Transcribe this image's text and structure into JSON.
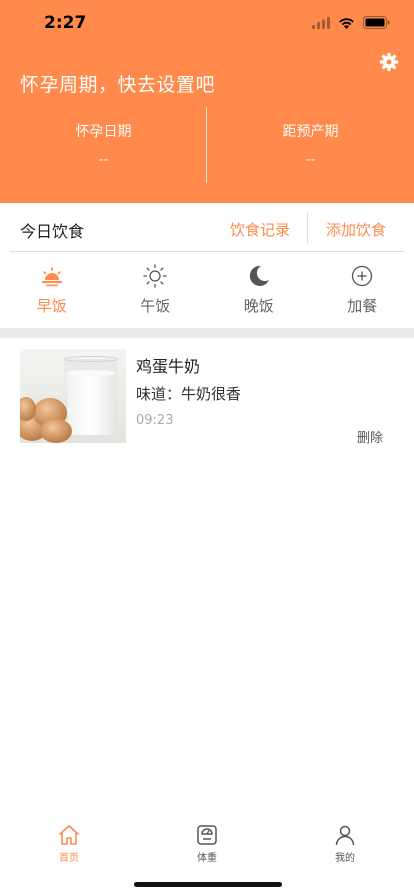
{
  "status_bar": {
    "time": "2:27"
  },
  "header": {
    "title": "怀孕周期，快去设置吧",
    "stats": [
      {
        "label": "怀孕日期",
        "value": "--"
      },
      {
        "label": "距预产期",
        "value": "--"
      }
    ],
    "settings_icon": "gear-icon"
  },
  "today": {
    "title": "今日饮食",
    "record_label": "饮食记录",
    "add_label": "添加饮食"
  },
  "meals": [
    {
      "label": "早饭",
      "icon": "sunrise-icon",
      "active": true
    },
    {
      "label": "午饭",
      "icon": "sun-icon",
      "active": false
    },
    {
      "label": "晚饭",
      "icon": "moon-icon",
      "active": false
    },
    {
      "label": "加餐",
      "icon": "plus-circle-icon",
      "active": false
    }
  ],
  "food_items": [
    {
      "name": "鸡蛋牛奶",
      "taste": "味道：牛奶很香",
      "time": "09:23",
      "delete_label": "删除"
    }
  ],
  "tabbar": [
    {
      "label": "首页",
      "icon": "home-icon",
      "active": true
    },
    {
      "label": "体重",
      "icon": "scale-icon",
      "active": false
    },
    {
      "label": "我的",
      "icon": "user-icon",
      "active": false
    }
  ],
  "colors": {
    "accent": "#FF8A4C",
    "separator": "#ebebeb"
  }
}
